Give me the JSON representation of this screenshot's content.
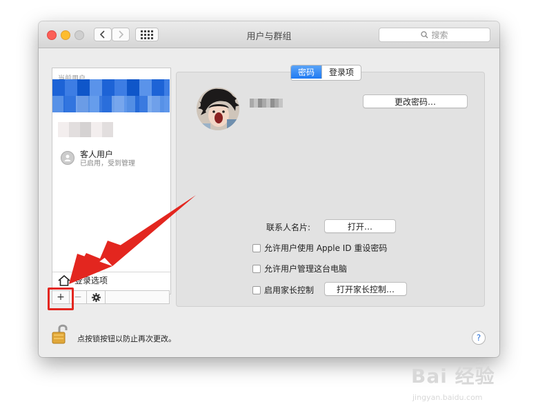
{
  "window": {
    "title": "用户与群组"
  },
  "search": {
    "placeholder": "搜索"
  },
  "sidebar": {
    "header": "当前用户",
    "guest": {
      "name": "客人用户",
      "status": "已启用，受到管理"
    },
    "login_options": "登录选项",
    "tools": {
      "add": "+",
      "remove": "−"
    }
  },
  "tabs": [
    {
      "label": "密码",
      "active": true
    },
    {
      "label": "登录项",
      "active": false
    }
  ],
  "panel": {
    "change_password_button": "更改密码…",
    "contact_card_label": "联系人名片:",
    "open_button": "打开…",
    "options": [
      {
        "label": "允许用户使用 Apple ID 重设密码",
        "checked": false
      },
      {
        "label": "允许用户管理这台电脑",
        "checked": false
      },
      {
        "label": "启用家长控制",
        "checked": false
      }
    ],
    "parental_controls_button": "打开家长控制…"
  },
  "footer": {
    "lock_text": "点按锁按钮以防止再次更改。",
    "help_label": "?"
  },
  "watermark": {
    "main": "Bai 经验",
    "sub": "jingyan.baidu.com"
  },
  "colors": {
    "accent": "#1f7af2",
    "annotation": "#e3261f"
  }
}
